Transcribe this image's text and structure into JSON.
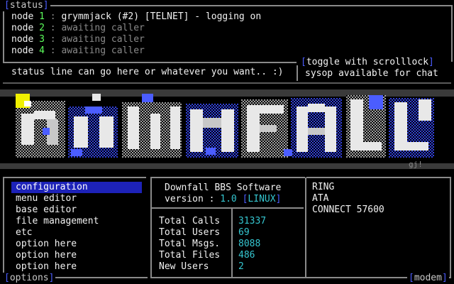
{
  "status_panel": {
    "title": "status",
    "nodes": [
      {
        "label": "node",
        "num": "1",
        "sep": ":",
        "text": "grymmjack (#2) [TELNET] - logging on",
        "active": true
      },
      {
        "label": "node",
        "num": "2",
        "sep": ":",
        "text": "awaiting caller",
        "active": false
      },
      {
        "label": "node",
        "num": "3",
        "sep": ":",
        "text": "awaiting caller",
        "active": false
      },
      {
        "label": "node",
        "num": "4",
        "sep": ":",
        "text": "awaiting caller",
        "active": false
      }
    ]
  },
  "status_line": {
    "text": "status line can go here or whatever you want.. :)",
    "toggle_hint": "toggle with scrolllock",
    "sysop_text": "sysop available for chat"
  },
  "logo": {
    "signature": "gj!"
  },
  "options_panel": {
    "title": "options",
    "items": [
      {
        "label": "configuration",
        "selected": true
      },
      {
        "label": "menu editor",
        "selected": false
      },
      {
        "label": "base editor",
        "selected": false
      },
      {
        "label": "file management",
        "selected": false
      },
      {
        "label": "etc",
        "selected": false
      },
      {
        "label": "option here",
        "selected": false
      },
      {
        "label": "option here",
        "selected": false
      },
      {
        "label": "option here",
        "selected": false
      }
    ]
  },
  "software": {
    "name": "Downfall BBS Software",
    "version_label": "version :",
    "version": "1.0",
    "platform": "LINUX"
  },
  "stats": [
    {
      "label": "Total Calls",
      "value": "31337"
    },
    {
      "label": "Total Users",
      "value": "69"
    },
    {
      "label": "Total Msgs.",
      "value": "8088"
    },
    {
      "label": "Total Files",
      "value": "486"
    },
    {
      "label": "New Users",
      "value": "2"
    }
  ],
  "modem_panel": {
    "title": "modem",
    "lines": [
      "RING",
      "ATA",
      "CONNECT 57600"
    ]
  },
  "colors": {
    "background": "#000000",
    "selection": "#1d22b8",
    "bracket": "#4b5dff",
    "node_number": "#5dff5d",
    "stat_value": "#35c6d0",
    "border": "#8a8a8a"
  }
}
